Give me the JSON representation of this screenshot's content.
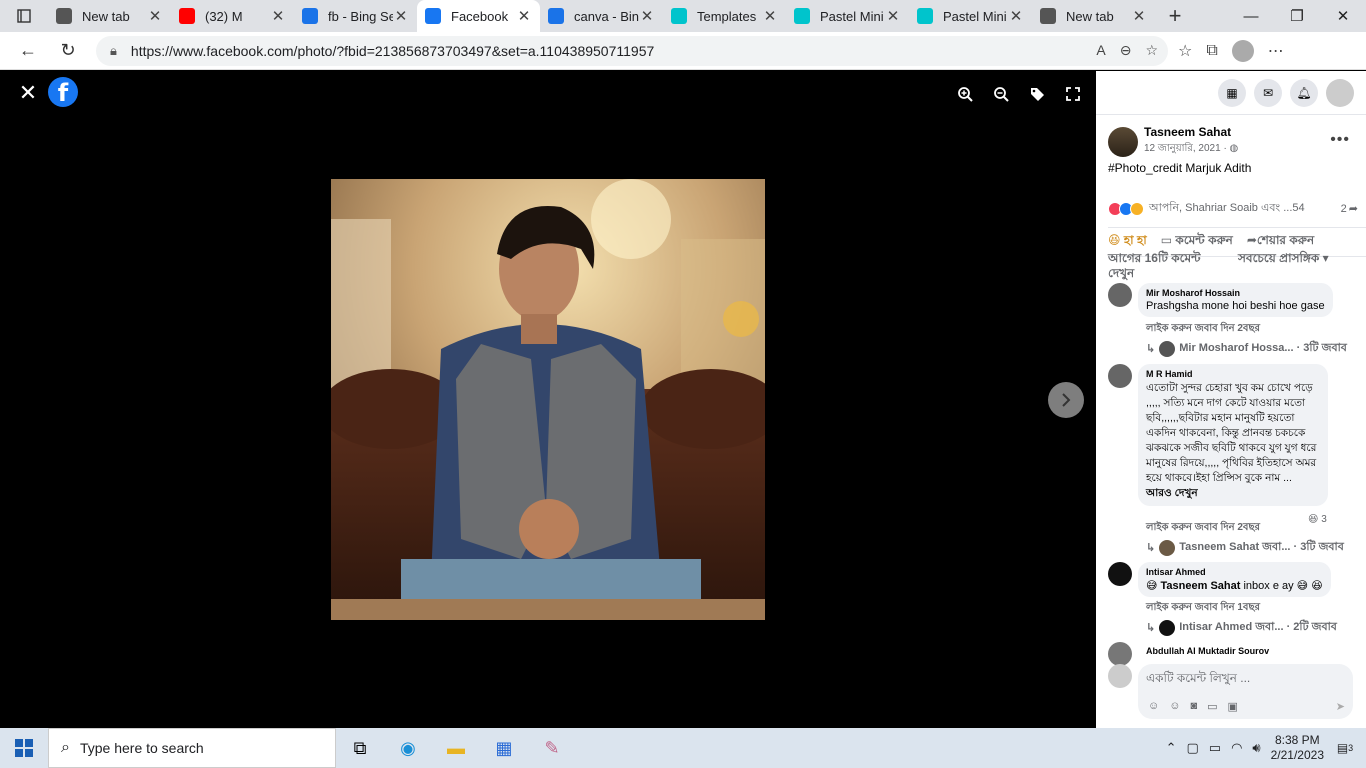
{
  "browser": {
    "tabs": [
      {
        "title": "New tab",
        "icon": "newtab-icon",
        "color": "#555555"
      },
      {
        "title": "(32) M",
        "icon": "youtube-icon",
        "color": "#ff0000"
      },
      {
        "title": "fb - Bing Se",
        "icon": "bing-search-icon",
        "color": "#1a73e8"
      },
      {
        "title": "Facebook",
        "icon": "facebook-icon",
        "color": "#1877f2",
        "active": true
      },
      {
        "title": "canva - Bin",
        "icon": "bing-search-icon",
        "color": "#1a73e8"
      },
      {
        "title": "Templates",
        "icon": "canva-icon",
        "color": "#00c4cc"
      },
      {
        "title": "Pastel Mini",
        "icon": "canva-icon",
        "color": "#00c4cc"
      },
      {
        "title": "Pastel Mini",
        "icon": "canva-icon",
        "color": "#00c4cc"
      },
      {
        "title": "New tab",
        "icon": "newtab-icon",
        "color": "#555555"
      }
    ],
    "url": "https://www.facebook.com/photo/?fbid=213856873703497&set=a.110438950711957"
  },
  "viewer": {
    "close_glyph": "✕",
    "logo_letter": "f"
  },
  "panel": {
    "author": {
      "name": "Tasneem Sahat",
      "date": "12 জানুয়ারি, 2021 · ◍"
    },
    "caption_tag": "#Photo_credit",
    "caption_rest": " Marjuk Adith",
    "reactions_text": "আপনি, Shahriar Soaib এবং ...54",
    "comment_count": "2",
    "actions": {
      "react": "হা হা",
      "comment": "কমেন্ট করুন",
      "share": "শেয়ার করুন"
    },
    "prev_comments": "আগের 16টি কমেন্ট দেখুন",
    "sort": "সবচেয়ে প্রাসঙ্গিক",
    "comments": [
      {
        "name": "Mir Mosharof Hossain",
        "text": "Prashgsha mone hoi beshi hoe gase",
        "meta": "লাইক করুন   জবাব দিন   2বছর",
        "reply": "Mir Mosharof Hossa... · 3টি জবাব"
      },
      {
        "name": "M R Hamid",
        "text": "এতোটা সুন্দর চেহারা খুব কম চোখে পড়ে ,,,,, সত্যি মনে দাগ কেটে যাওয়ার মতো ছবি,,,,,,ছবিটার মহান মানুষটি হয়তো একদিন থাকবেনা, কিন্তু প্রানবন্ত চকচকে ঝকঝকে সজীব ছবিটি থাকবে যুগ যুগ ধরে মানুষের রিদয়ে,,,,, পৃথিবির ইতিহাসে অমর হয়ে থাকবে।ইহা প্রিন্সিস বুকে নাম ...",
        "see_more": "আরও দেখুন",
        "reaction_count": "3",
        "meta": "লাইক করুন   জবাব দিন   2বছর",
        "reply": "Tasneem Sahat জবা... · 3টি জবাব"
      },
      {
        "name": "Intisar Ahmed",
        "mention": "Tasneem Sahat",
        "text": " inbox e ay",
        "meta": "লাইক করুন   জবাব দিন   1বছর",
        "reply": "Intisar Ahmed জবা... · 2টি জবাব"
      },
      {
        "name": "Abdullah Al Muktadir Sourov"
      }
    ],
    "write_placeholder": "একটি কমেন্ট লিখুন ..."
  },
  "taskbar": {
    "search_placeholder": "Type here to search",
    "time": "8:38 PM",
    "date": "2/21/2023",
    "notification_count": "3"
  }
}
